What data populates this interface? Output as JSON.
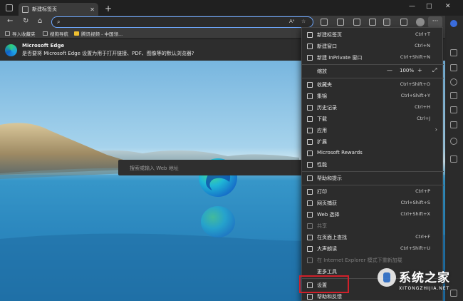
{
  "tab": {
    "title": "新建标签页"
  },
  "tabbar": {
    "new_tab": "+",
    "minimize": "—",
    "maximize": "□",
    "close": "✕"
  },
  "navbar": {
    "back": "←",
    "refresh": "↻",
    "home": "⌂",
    "more": "···"
  },
  "favorites": [
    {
      "label": "导入收藏夹",
      "icon": "folder-icon"
    },
    {
      "label": "搜狗导航",
      "icon": "page-icon"
    },
    {
      "label": "腾讯视频 - 中国领...",
      "icon": "video-icon"
    }
  ],
  "notice": {
    "title": "Microsoft Edge",
    "message": "是否要将 Microsoft Edge 设置为用于打开链接、PDF、图像等的默认浏览器?"
  },
  "search": {
    "placeholder": "搜索或输入 Web 地址"
  },
  "menu": {
    "items": [
      {
        "label": "新建标签页",
        "shortcut": "Ctrl+T"
      },
      {
        "label": "新建窗口",
        "shortcut": "Ctrl+N"
      },
      {
        "label": "新建 InPrivate 窗口",
        "shortcut": "Ctrl+Shift+N"
      },
      {
        "label": "收藏夹",
        "shortcut": "Ctrl+Shift+O"
      },
      {
        "label": "集锦",
        "shortcut": "Ctrl+Shift+Y"
      },
      {
        "label": "历史记录",
        "shortcut": "Ctrl+H"
      },
      {
        "label": "下载",
        "shortcut": "Ctrl+J"
      },
      {
        "label": "应用",
        "shortcut": ""
      },
      {
        "label": "扩展",
        "shortcut": ""
      },
      {
        "label": "Microsoft Rewards",
        "shortcut": ""
      },
      {
        "label": "性能",
        "shortcut": ""
      },
      {
        "label": "帮助和提示",
        "shortcut": ""
      },
      {
        "label": "打印",
        "shortcut": "Ctrl+P"
      },
      {
        "label": "网页捕获",
        "shortcut": "Ctrl+Shift+S"
      },
      {
        "label": "Web 选择",
        "shortcut": "Ctrl+Shift+X"
      },
      {
        "label": "共享",
        "shortcut": ""
      },
      {
        "label": "在页面上查找",
        "shortcut": "Ctrl+F"
      },
      {
        "label": "大声朗读",
        "shortcut": "Ctrl+Shift+U"
      },
      {
        "label": "在 Internet Explorer 模式下重新加载",
        "shortcut": ""
      },
      {
        "label": "更多工具",
        "shortcut": ""
      },
      {
        "label": "设置",
        "shortcut": ""
      },
      {
        "label": "帮助和反馈",
        "shortcut": ""
      }
    ],
    "zoom": {
      "label": "缩放",
      "minus": "—",
      "value": "100%",
      "plus": "+"
    },
    "submenu_arrow": "›"
  },
  "watermark": {
    "title": "系统之家",
    "subtitle": "XITONGZHIJIA.NET"
  }
}
